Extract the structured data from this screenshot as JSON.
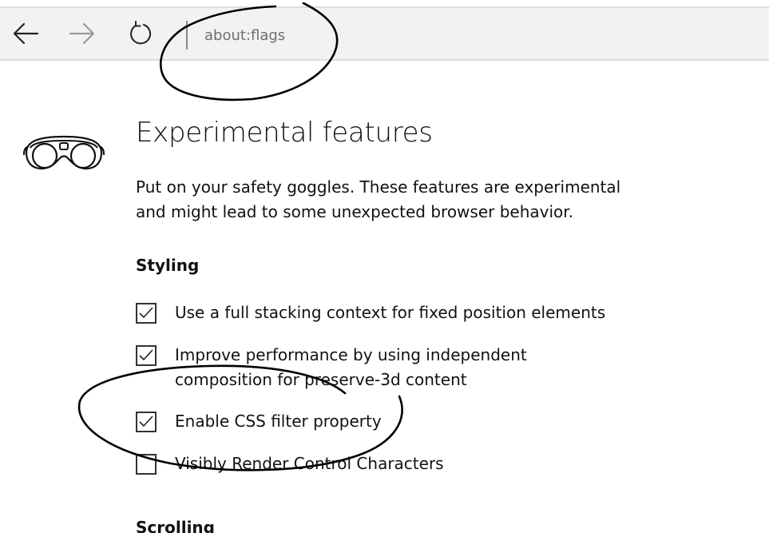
{
  "browser": {
    "address_value": "about:flags",
    "back_icon": "back-arrow-icon",
    "forward_icon": "forward-arrow-icon",
    "refresh_icon": "refresh-icon"
  },
  "page": {
    "icon": "safety-goggles-icon",
    "title": "Experimental features",
    "description": "Put on your safety goggles. These features are experimental and might lead to some unexpected browser behavior."
  },
  "sections": [
    {
      "title": "Styling",
      "options": [
        {
          "label": "Use a full stacking context for fixed position elements",
          "checked": true
        },
        {
          "label": "Improve performance by using independent composition for preserve-3d content",
          "checked": true
        },
        {
          "label": "Enable CSS filter property",
          "checked": true
        },
        {
          "label": "Visibly Render Control Characters",
          "checked": false
        }
      ]
    },
    {
      "title": "Scrolling"
    }
  ],
  "colors": {
    "toolbar_bg": "#f2f2f2",
    "ink": "#000000",
    "text": "#111111",
    "address_text": "#6e6e6e"
  }
}
